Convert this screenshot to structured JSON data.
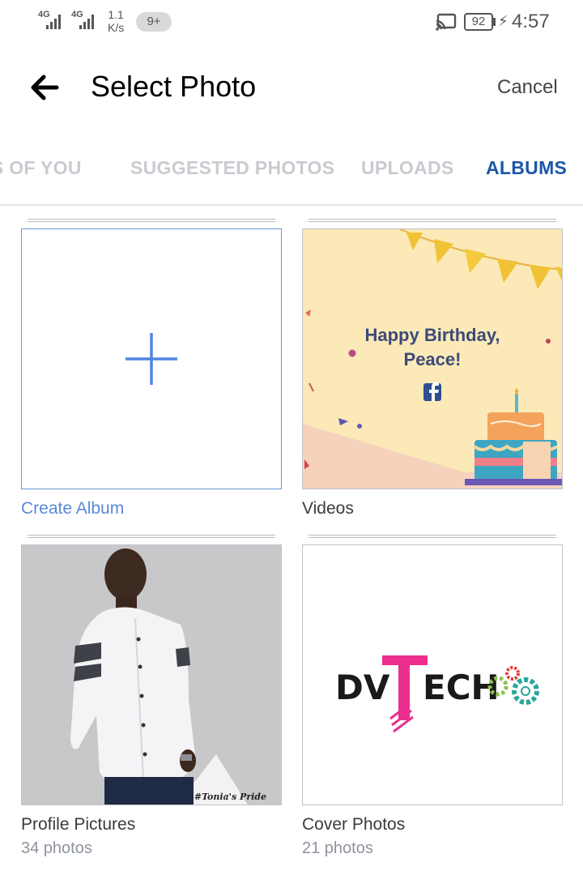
{
  "status_bar": {
    "network_1": "4G",
    "network_2": "4G",
    "speed_value": "1.1",
    "speed_unit": "K/s",
    "notification_badge": "9+",
    "battery": "92",
    "time": "4:57"
  },
  "header": {
    "title": "Select Photo",
    "cancel_label": "Cancel"
  },
  "tabs": [
    {
      "label": "PHOTOS OF YOU",
      "active": false
    },
    {
      "label": "SUGGESTED PHOTOS",
      "active": false
    },
    {
      "label": "UPLOADS",
      "active": false
    },
    {
      "label": "ALBUMS",
      "active": true
    }
  ],
  "albums": [
    {
      "name": "Create Album",
      "count": ""
    },
    {
      "name": "Videos",
      "count": "",
      "thumb_text_line1": "Happy Birthday,",
      "thumb_text_line2": "Peace!"
    },
    {
      "name": "Profile Pictures",
      "count": "34 photos",
      "thumb_caption": "#Tonia's Pride"
    },
    {
      "name": "Cover Photos",
      "count": "21 photos",
      "logo_text_1": "DV",
      "logo_text_2": "T",
      "logo_text_3": "ECH"
    }
  ],
  "colors": {
    "accent": "#1b57a8",
    "create_blue": "#5a8ad6",
    "tab_inactive": "#c8cbd0"
  }
}
